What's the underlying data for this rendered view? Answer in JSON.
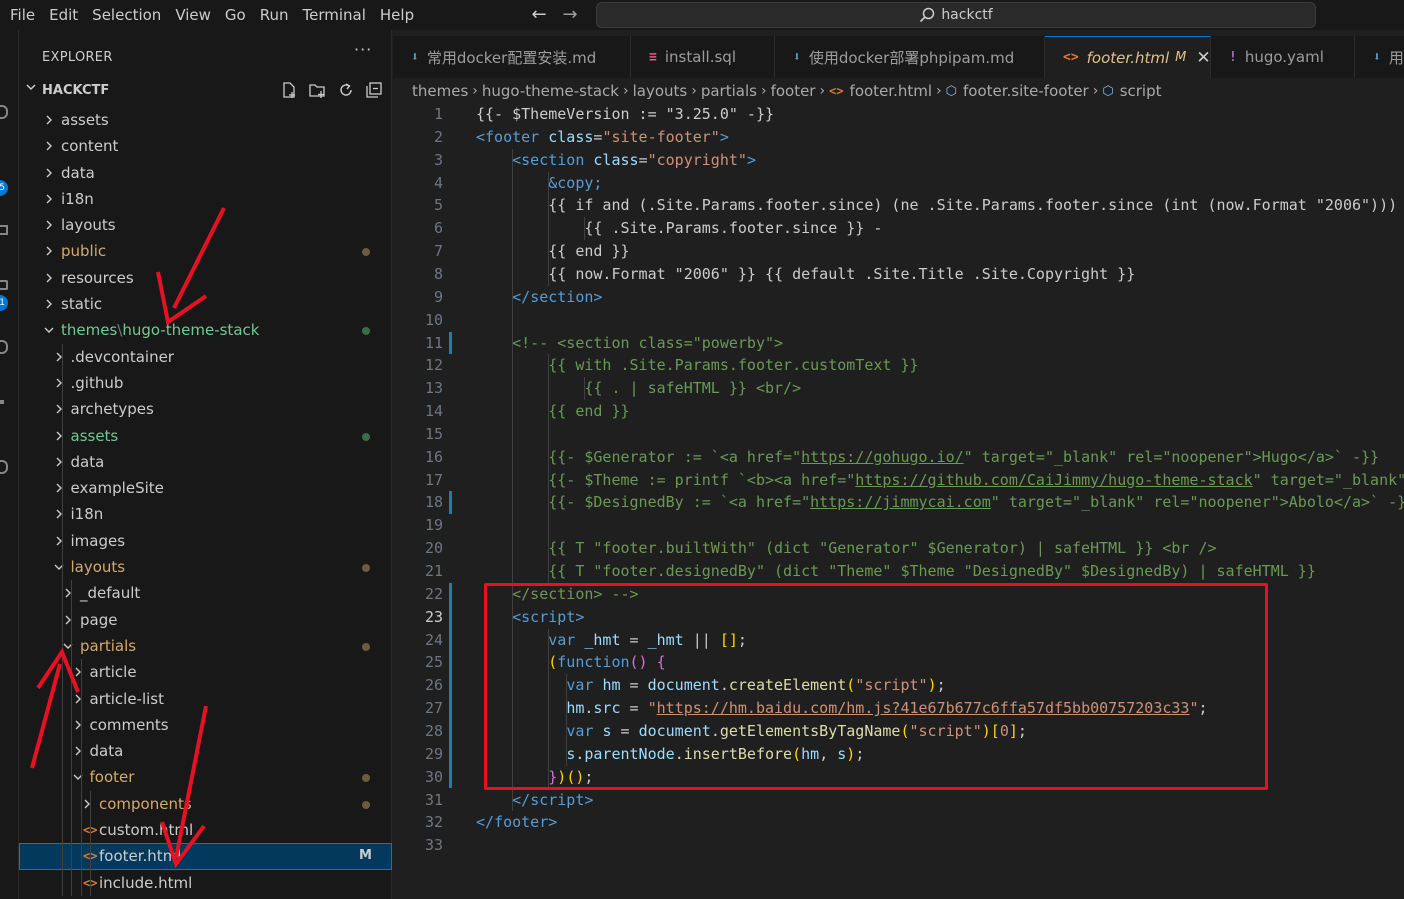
{
  "menu": [
    "File",
    "Edit",
    "Selection",
    "View",
    "Go",
    "Run",
    "Terminal",
    "Help"
  ],
  "search": {
    "text": "hackctf"
  },
  "explorer": {
    "title": "EXPLORER",
    "more": "···",
    "section": "HACKCTF",
    "tree": [
      {
        "label": "assets",
        "color": "white",
        "depth": 0,
        "chev": "right"
      },
      {
        "label": "content",
        "color": "white",
        "depth": 0,
        "chev": "right"
      },
      {
        "label": "data",
        "color": "white",
        "depth": 0,
        "chev": "right"
      },
      {
        "label": "i18n",
        "color": "white",
        "depth": 0,
        "chev": "right"
      },
      {
        "label": "layouts",
        "color": "white",
        "depth": 0,
        "chev": "right"
      },
      {
        "label": "public",
        "color": "yellow",
        "depth": 0,
        "chev": "right",
        "dot": "yellow"
      },
      {
        "label": "resources",
        "color": "white",
        "depth": 0,
        "chev": "right"
      },
      {
        "label": "static",
        "color": "white",
        "depth": 0,
        "chev": "right"
      },
      {
        "label": "themes",
        "sep": "\\",
        "label2": "hugo-theme-stack",
        "color": "green",
        "depth": 0,
        "chev": "down",
        "dot": "green"
      },
      {
        "label": ".devcontainer",
        "color": "white",
        "depth": 1,
        "chev": "right"
      },
      {
        "label": ".github",
        "color": "white",
        "depth": 1,
        "chev": "right"
      },
      {
        "label": "archetypes",
        "color": "white",
        "depth": 1,
        "chev": "right"
      },
      {
        "label": "assets",
        "color": "green",
        "depth": 1,
        "chev": "right",
        "dot": "green"
      },
      {
        "label": "data",
        "color": "white",
        "depth": 1,
        "chev": "right"
      },
      {
        "label": "exampleSite",
        "color": "white",
        "depth": 1,
        "chev": "right"
      },
      {
        "label": "i18n",
        "color": "white",
        "depth": 1,
        "chev": "right"
      },
      {
        "label": "images",
        "color": "white",
        "depth": 1,
        "chev": "right"
      },
      {
        "label": "layouts",
        "color": "yellow",
        "depth": 1,
        "chev": "down",
        "dot": "yellow"
      },
      {
        "label": "_default",
        "color": "white",
        "depth": 2,
        "chev": "right"
      },
      {
        "label": "page",
        "color": "white",
        "depth": 2,
        "chev": "right"
      },
      {
        "label": "partials",
        "color": "yellow",
        "depth": 2,
        "chev": "down",
        "dot": "yellow"
      },
      {
        "label": "article",
        "color": "white",
        "depth": 3,
        "chev": "right"
      },
      {
        "label": "article-list",
        "color": "white",
        "depth": 3,
        "chev": "right"
      },
      {
        "label": "comments",
        "color": "white",
        "depth": 3,
        "chev": "right"
      },
      {
        "label": "data",
        "color": "white",
        "depth": 3,
        "chev": "right"
      },
      {
        "label": "footer",
        "color": "yellow",
        "depth": 3,
        "chev": "down",
        "dot": "yellow"
      },
      {
        "label": "components",
        "color": "yellow",
        "depth": 4,
        "chev": "right",
        "dot": "yellow"
      },
      {
        "label": "custom.html",
        "color": "white",
        "depth": 4,
        "file": "<>"
      },
      {
        "label": "footer.html",
        "color": "white",
        "depth": 4,
        "file": "<>",
        "badge": "M",
        "selected": true
      },
      {
        "label": "include.html",
        "color": "white",
        "depth": 4,
        "file": "<>"
      }
    ]
  },
  "tabs": [
    {
      "label": "常用docker配置安装.md",
      "icon": "⬇",
      "icon_color": "#519aba"
    },
    {
      "label": "install.sql",
      "icon": "≡",
      "icon_color": "#f55385"
    },
    {
      "label": "使用docker部署phpipam.md",
      "icon": "⬇",
      "icon_color": "#519aba"
    },
    {
      "label": "footer.html",
      "icon": "<>",
      "icon_color": "#e37933",
      "mod": "M",
      "close": "✕",
      "active": true
    },
    {
      "label": "hugo.yaml",
      "icon": "!",
      "icon_color": "#a074c4"
    },
    {
      "label": "用",
      "icon": "⬇",
      "icon_color": "#519aba"
    }
  ],
  "breadcrumb": [
    "themes",
    "hugo-theme-stack",
    "layouts",
    "partials",
    "footer",
    "footer.html",
    "footer.site-footer",
    "script"
  ],
  "code": {
    "current_line": 23,
    "lines": [
      [
        [
          "{{- $ThemeVersion := \"3.25.0\" -}}",
          "c-white"
        ]
      ],
      [
        [
          "<",
          "tk-tag"
        ],
        [
          "footer",
          "tk-tag"
        ],
        [
          " ",
          ""
        ],
        [
          "class",
          "tk-attr"
        ],
        [
          "=",
          "c-white"
        ],
        [
          "\"site-footer\"",
          "tk-str"
        ],
        [
          ">",
          "tk-tag"
        ]
      ],
      [
        [
          "    ",
          ""
        ],
        [
          "<",
          "tk-tag"
        ],
        [
          "section",
          "tk-tag"
        ],
        [
          " ",
          ""
        ],
        [
          "class",
          "tk-attr"
        ],
        [
          "=",
          "c-white"
        ],
        [
          "\"copyright\"",
          "tk-str"
        ],
        [
          ">",
          "tk-tag"
        ]
      ],
      [
        [
          "        ",
          ""
        ],
        [
          "&copy;",
          "tk-ent"
        ]
      ],
      [
        [
          "        {{ if and (.Site.Params.footer.since) (ne .Site.Params.footer.since (int (now.Format \"2006\")))",
          "c-white"
        ]
      ],
      [
        [
          "            {{ .Site.Params.footer.since }} -",
          "c-white"
        ]
      ],
      [
        [
          "        {{ end }}",
          "c-white"
        ]
      ],
      [
        [
          "        {{ now.Format \"2006\" }} {{ default .Site.Title .Site.Copyright }}",
          "c-white"
        ]
      ],
      [
        [
          "    ",
          ""
        ],
        [
          "</",
          "tk-tag"
        ],
        [
          "section",
          "tk-tag"
        ],
        [
          ">",
          "tk-tag"
        ]
      ],
      [
        [
          "",
          ""
        ]
      ],
      [
        [
          "    <!-- <section class=\"powerby\">",
          "tk-com"
        ]
      ],
      [
        [
          "        {{ with .Site.Params.footer.customText }}",
          "tk-com"
        ]
      ],
      [
        [
          "            {{ . | safeHTML }} <br/>",
          "tk-com"
        ]
      ],
      [
        [
          "        {{ end }}",
          "tk-com"
        ]
      ],
      [
        [
          "",
          ""
        ]
      ],
      [
        [
          "        {{- $Generator := `<a href=\"",
          "tk-com"
        ],
        [
          "https://gohugo.io/",
          "tk-com tk-ul"
        ],
        [
          "\" target=\"_blank\" rel=\"noopener\">Hugo</a>` -}}",
          "tk-com"
        ]
      ],
      [
        [
          "        {{- $Theme := printf `<b><a href=\"",
          "tk-com"
        ],
        [
          "https://github.com/CaiJimmy/hugo-theme-stack",
          "tk-com tk-ul"
        ],
        [
          "\" target=\"_blank\" rel=\"noopener\" data-version=\"%s\">Stack</a></b>` $ThemeVersion -}}",
          "tk-com"
        ]
      ],
      [
        [
          "        {{- $DesignedBy := `<a href=\"",
          "tk-com"
        ],
        [
          "https://jimmycai.com",
          "tk-com tk-ul"
        ],
        [
          "\" target=\"_blank\" rel=\"noopener\">Abolo</a>` -}}",
          "tk-com"
        ]
      ],
      [
        [
          "",
          ""
        ]
      ],
      [
        [
          "        {{ T \"footer.builtWith\" (dict \"Generator\" $Generator) | safeHTML }} <br />",
          "tk-com"
        ]
      ],
      [
        [
          "        {{ T \"footer.designedBy\" (dict \"Theme\" $Theme \"DesignedBy\" $DesignedBy) | safeHTML }}",
          "tk-com"
        ]
      ],
      [
        [
          "    </section> -->",
          "tk-com"
        ]
      ],
      [
        [
          "    ",
          ""
        ],
        [
          "<",
          "tk-tag"
        ],
        [
          "script",
          "tk-tag"
        ],
        [
          ">",
          "tk-tag"
        ]
      ],
      [
        [
          "        ",
          ""
        ],
        [
          "var",
          "tk-kw"
        ],
        [
          " ",
          ""
        ],
        [
          "_hmt",
          "tk-var"
        ],
        [
          " = ",
          "c-white"
        ],
        [
          "_hmt",
          "tk-var"
        ],
        [
          " || ",
          "c-white"
        ],
        [
          "[]",
          "tk-br1"
        ],
        [
          ";",
          "c-white"
        ]
      ],
      [
        [
          "        ",
          ""
        ],
        [
          "(",
          "tk-br1"
        ],
        [
          "function",
          "tk-kw"
        ],
        [
          "()",
          "tk-br2"
        ],
        [
          " ",
          ""
        ],
        [
          "{",
          "tk-br2"
        ]
      ],
      [
        [
          "          ",
          ""
        ],
        [
          "var",
          "tk-kw"
        ],
        [
          " ",
          ""
        ],
        [
          "hm",
          "tk-var"
        ],
        [
          " = ",
          "c-white"
        ],
        [
          "document",
          "tk-var"
        ],
        [
          ".",
          "c-white"
        ],
        [
          "createElement",
          "tk-fn"
        ],
        [
          "(",
          "tk-br1"
        ],
        [
          "\"script\"",
          "tk-str"
        ],
        [
          ")",
          "tk-br1"
        ],
        [
          ";",
          "c-white"
        ]
      ],
      [
        [
          "          ",
          ""
        ],
        [
          "hm",
          "tk-var"
        ],
        [
          ".",
          "c-white"
        ],
        [
          "src",
          "tk-var"
        ],
        [
          " = ",
          "c-white"
        ],
        [
          "\"",
          "tk-str"
        ],
        [
          "https://hm.baidu.com/hm.js?41e67b677c6ffa57df5bb00757203c33",
          "tk-link"
        ],
        [
          "\"",
          "tk-str"
        ],
        [
          ";",
          "c-white"
        ]
      ],
      [
        [
          "          ",
          ""
        ],
        [
          "var",
          "tk-kw"
        ],
        [
          " ",
          ""
        ],
        [
          "s",
          "tk-var"
        ],
        [
          " = ",
          "c-white"
        ],
        [
          "document",
          "tk-var"
        ],
        [
          ".",
          "c-white"
        ],
        [
          "getElementsByTagName",
          "tk-fn"
        ],
        [
          "(",
          "tk-br1"
        ],
        [
          "\"script\"",
          "tk-str"
        ],
        [
          ")",
          "tk-br1"
        ],
        [
          "[",
          "tk-br1"
        ],
        [
          "0",
          "tk-str"
        ],
        [
          "]",
          "tk-br1"
        ],
        [
          ";",
          "c-white"
        ]
      ],
      [
        [
          "          ",
          ""
        ],
        [
          "s",
          "tk-var"
        ],
        [
          ".",
          "c-white"
        ],
        [
          "parentNode",
          "tk-var"
        ],
        [
          ".",
          "c-white"
        ],
        [
          "insertBefore",
          "tk-fn"
        ],
        [
          "(",
          "tk-br1"
        ],
        [
          "hm",
          "tk-var"
        ],
        [
          ", ",
          "c-white"
        ],
        [
          "s",
          "tk-var"
        ],
        [
          ")",
          "tk-br1"
        ],
        [
          ";",
          "c-white"
        ]
      ],
      [
        [
          "        ",
          ""
        ],
        [
          "}",
          "tk-br2"
        ],
        [
          ")",
          "tk-br1"
        ],
        [
          "()",
          "tk-br1"
        ],
        [
          ";",
          "c-white"
        ]
      ],
      [
        [
          "    ",
          ""
        ],
        [
          "</",
          "tk-tag"
        ],
        [
          "script",
          "tk-tag"
        ],
        [
          ">",
          "tk-tag"
        ]
      ],
      [
        [
          "</",
          "tk-tag"
        ],
        [
          "footer",
          "tk-tag"
        ],
        [
          ">",
          "tk-tag"
        ]
      ],
      [
        [
          "",
          ""
        ]
      ]
    ]
  },
  "colors": {
    "accent": "#0078d4",
    "annotation": "#e81123",
    "modified": "#e2c08d",
    "untracked": "#73c991"
  }
}
